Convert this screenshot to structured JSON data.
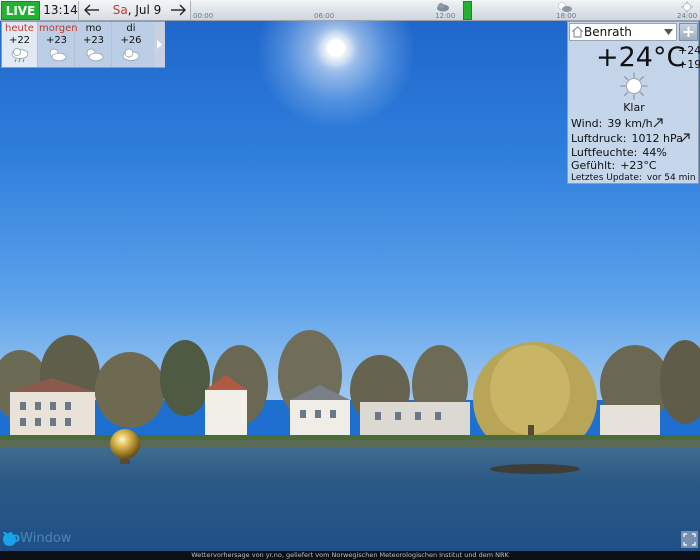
{
  "topbar": {
    "live_label": "LIVE",
    "time": "13:14",
    "prev_icon": "arrow-left-icon",
    "next_icon": "arrow-right-icon",
    "date_dow": "Sa",
    "date_rest": ", Jul 9",
    "timeline_ticks": [
      "00:00",
      "06:00",
      "12:00",
      "18:00",
      "24:00"
    ],
    "timeline_icons": [
      "cloud-sun-icon",
      "sun-cloud-icon",
      "sun-icon"
    ]
  },
  "forecast": {
    "days": [
      {
        "name": "heute",
        "temp": "+22",
        "icon": "cloud-rain-icon"
      },
      {
        "name": "morgen",
        "temp": "+23",
        "icon": "sun-cloud-icon"
      },
      {
        "name": "mo",
        "temp": "+23",
        "icon": "sun-cloud-icon"
      },
      {
        "name": "di",
        "temp": "+26",
        "icon": "cloud-icon"
      }
    ],
    "more_icon": "chevron-right-icon"
  },
  "current": {
    "location": "Benrath",
    "temperature": "+24°C",
    "high": "+24",
    "low": "+19",
    "condition": "Klar",
    "wind_label": "Wind:",
    "wind_value": "39 km/h",
    "pressure_label": "Luftdruck:",
    "pressure_value": "1012 hPa",
    "humidity_label": "Luftfeuchte:",
    "humidity_value": "44%",
    "feels_label": "Gefühlt:",
    "feels_value": "+23°C",
    "update_label": "Letztes Update:",
    "update_value": "vor 54 min",
    "add_label": "+"
  },
  "footer": {
    "credit": "Wettervorhersage von yr.no, geliefert vom Norwegischen Meteorologischen Institut und dem NRK",
    "logo_yo": "Yo",
    "logo_rest": "Window"
  },
  "colors": {
    "live_green": "#22b231",
    "day_red": "#c0392b",
    "sky": "#2f7fdc"
  }
}
